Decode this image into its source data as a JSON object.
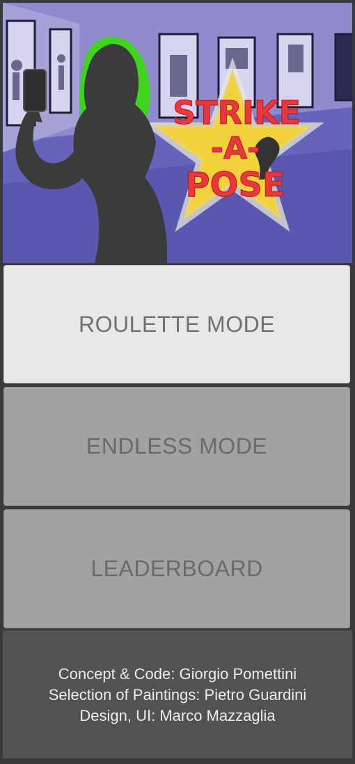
{
  "hero": {
    "logo_line1": "STRIKE",
    "logo_line2": "-A-",
    "logo_line3": "POSE",
    "colors": {
      "wall": "#8a86c8",
      "floor": "#5a57b4",
      "silhouette": "#3b3b3b",
      "hair": "#3fd21f",
      "star": "#f2d23c",
      "logo_text": "#e8383c"
    }
  },
  "menu": {
    "roulette_label": "ROULETTE MODE",
    "endless_label": "ENDLESS MODE",
    "leaderboard_label": "LEADERBOARD"
  },
  "credits": {
    "line1": "Concept & Code: Giorgio Pomettini",
    "line2": "Selection of Paintings: Pietro Guardini",
    "line3": "Design, UI: Marco Mazzaglia"
  }
}
